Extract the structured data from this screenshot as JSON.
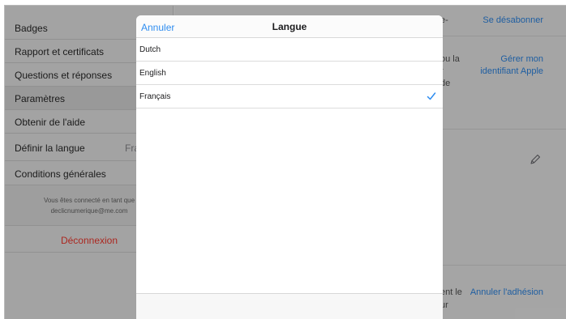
{
  "sidebar": {
    "items": [
      {
        "label": "Badges",
        "value": ""
      },
      {
        "label": "Rapport et certificats",
        "value": ""
      },
      {
        "label": "Questions et réponses",
        "value": ""
      },
      {
        "label": "Paramètres",
        "value": ""
      },
      {
        "label": "Obtenir de l'aide",
        "value": ""
      },
      {
        "label": "Définir la langue",
        "value": "Fra"
      },
      {
        "label": "Conditions générales",
        "value": ""
      }
    ],
    "session_line1": "Vous êtes connecté en tant que",
    "session_email": "declicnumerique@me.com",
    "logout_label": "Déconnexion"
  },
  "content": {
    "fragment_1": "e-",
    "unsubscribe_link": "Se désabonner",
    "fragment_2": "ou la",
    "fragment_3": "r",
    "fragment_4": "de",
    "manage_id_link_line1": "Gérer mon",
    "manage_id_link_line2": "identifiant Apple",
    "fragment_5": "ent le",
    "fragment_6": "ur",
    "cancel_membership_link": "Annuler l'adhésion"
  },
  "modal": {
    "cancel_label": "Annuler",
    "title": "Langue",
    "languages": [
      {
        "name": "Dutch",
        "selected": false
      },
      {
        "name": "English",
        "selected": false
      },
      {
        "name": "Français",
        "selected": true
      }
    ]
  },
  "colors": {
    "accent": "#2f8df0",
    "destructive": "#ff3b30"
  },
  "icons": {
    "check": "checkmark-icon",
    "edit": "pencil-icon"
  }
}
